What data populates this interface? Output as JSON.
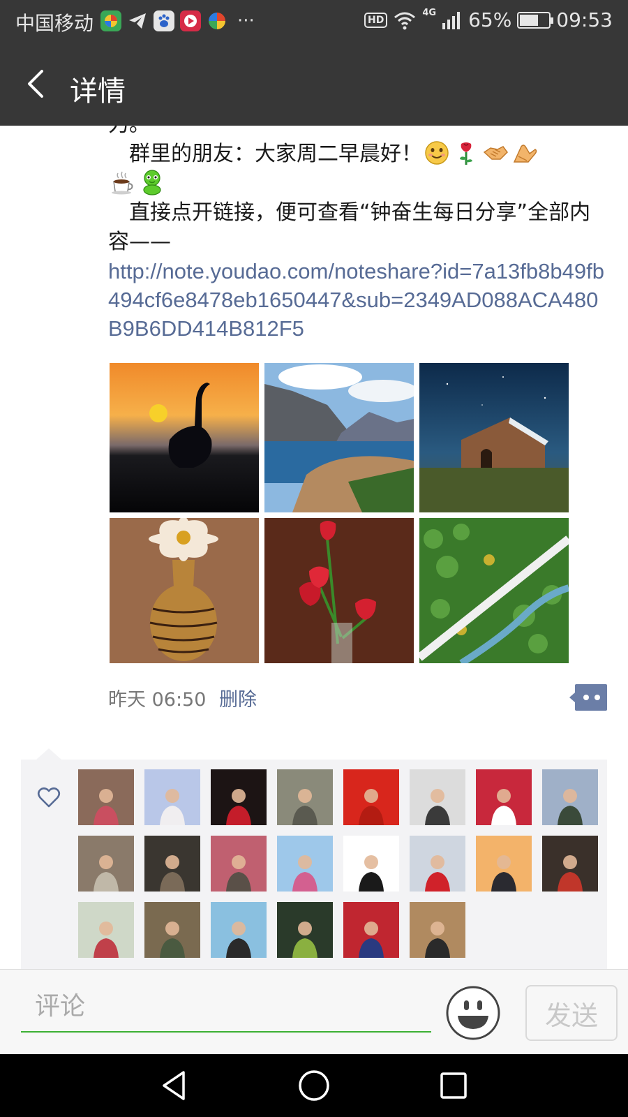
{
  "status_bar": {
    "carrier": "中国移动",
    "apps": [
      "app-1",
      "telegram",
      "baidu",
      "app-video",
      "app-4"
    ],
    "dots": "···",
    "hd": "HD",
    "network": "4G",
    "battery_percent_text": "65%",
    "battery_level": 0.65,
    "time": "09:53"
  },
  "title_bar": {
    "title": "详情",
    "back_icon": "back-chevron-icon"
  },
  "post": {
    "line0": "力。",
    "greeting": "　群里的朋友：大家周二早晨好！",
    "greeting_emojis": [
      "smile-emoji",
      "rose-emoji",
      "handshake-emoji",
      "clap-emoji",
      "coffee-emoji",
      "frog-emoji"
    ],
    "link_intro": "　直接点开链接，便可查看“钟奋生每日分享”全部内容——",
    "link": "http://note.youdao.com/noteshare?id=7a13fb8b49fb494cf6e8478eb1650447&sub=2349AD088ACA480B9B6DD414B812F5",
    "photos": [
      "sunset-crane-photo",
      "lake-mountain-town-photo",
      "stone-chapel-night-photo",
      "daisy-vase-photo",
      "red-tulips-photo",
      "aerial-river-forest-photo"
    ],
    "time": "昨天 06:50",
    "delete_label": "删除"
  },
  "likes": {
    "icon": "heart-outline-icon",
    "avatars": [
      {
        "c1": "#8a6a5a",
        "c2": "#c94f60"
      },
      {
        "c1": "#b9c7e8",
        "c2": "#f0eef0"
      },
      {
        "c1": "#1c1414",
        "c2": "#c41d2a"
      },
      {
        "c1": "#8a8a7a",
        "c2": "#5a5a50"
      },
      {
        "c1": "#d8261c",
        "c2": "#b31c12"
      },
      {
        "c1": "#dcdcdc",
        "c2": "#3a3a3a"
      },
      {
        "c1": "#c8283c",
        "c2": "#ffffff"
      },
      {
        "c1": "#9fb0c8",
        "c2": "#3a4a3a"
      },
      {
        "c1": "#8a7a6a",
        "c2": "#c0b8a8"
      },
      {
        "c1": "#3a3630",
        "c2": "#7a6a58"
      },
      {
        "c1": "#c06070",
        "c2": "#5a5048"
      },
      {
        "c1": "#9ec8ea",
        "c2": "#d36090"
      },
      {
        "c1": "#ffffff",
        "c2": "#1a1a1a"
      },
      {
        "c1": "#cfd6e0",
        "c2": "#d0222a"
      },
      {
        "c1": "#f3b36a",
        "c2": "#2a2a30"
      },
      {
        "c1": "#3a302a",
        "c2": "#c0362a"
      },
      {
        "c1": "#cfd8c8",
        "c2": "#c0404a"
      },
      {
        "c1": "#7a6a50",
        "c2": "#4a5a40"
      },
      {
        "c1": "#8ac0e0",
        "c2": "#2a2a2a"
      },
      {
        "c1": "#2a3a2a",
        "c2": "#8ab040"
      },
      {
        "c1": "#c02630",
        "c2": "#2a3a80"
      },
      {
        "c1": "#b08a60",
        "c2": "#2a2a2a"
      }
    ]
  },
  "comment_bar": {
    "placeholder": "评论",
    "send_label": "发送"
  },
  "nav": [
    "back-triangle-icon",
    "home-circle-icon",
    "recents-square-icon"
  ],
  "colors": {
    "bar_bg": "#373737",
    "link": "#576b95",
    "input_underline": "#3cb034",
    "likes_bg": "#f3f3f5"
  }
}
